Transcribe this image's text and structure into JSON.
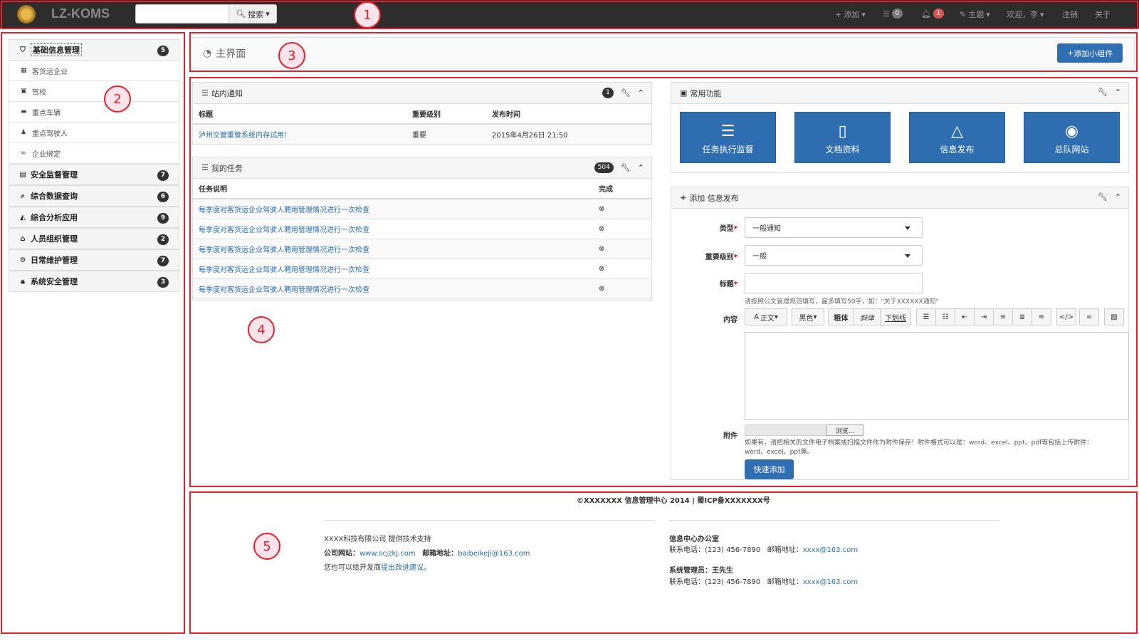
{
  "navbar": {
    "brand": "LZ-KOMS",
    "search_label": "搜索",
    "add_label": "添加",
    "messages_count": "0",
    "alerts_count": "1",
    "theme_label": "主题",
    "welcome_label": "欢迎，李",
    "logout_label": "注销",
    "about_label": "关于"
  },
  "sidebar": {
    "groups": [
      {
        "label": "基础信息管理",
        "count": "5",
        "icon": "shield-icon"
      },
      {
        "label": "安全监督管理",
        "count": "7",
        "icon": "book-icon"
      },
      {
        "label": "综合数据查询",
        "count": "6",
        "icon": "search-icon"
      },
      {
        "label": "综合分析应用",
        "count": "9",
        "icon": "chart-icon"
      },
      {
        "label": "人员组织管理",
        "count": "2",
        "icon": "institution-icon"
      },
      {
        "label": "日常维护管理",
        "count": "7",
        "icon": "gears-icon"
      },
      {
        "label": "系统安全管理",
        "count": "3",
        "icon": "lock-icon"
      }
    ],
    "sub_items": [
      {
        "label": "客货运企业",
        "icon": "building-icon"
      },
      {
        "label": "驾校",
        "icon": "car-icon"
      },
      {
        "label": "重点车辆",
        "icon": "truck-icon"
      },
      {
        "label": "重点驾驶人",
        "icon": "person-icon"
      },
      {
        "label": "企业绑定",
        "icon": "link-icon"
      }
    ]
  },
  "main": {
    "title": "主界面",
    "add_widget_label": "添加小组件"
  },
  "notices": {
    "title": "站内通知",
    "count": "1",
    "columns": [
      "标题",
      "重要级别",
      "发布时间"
    ],
    "rows": [
      {
        "title": "泸州交管重管系统内存试用！",
        "level": "重要",
        "time": "2015年4月26日 21:50"
      }
    ]
  },
  "tasks": {
    "title": "我的任务",
    "count": "504",
    "columns": [
      "任务说明",
      "完成"
    ],
    "rows": [
      "每季度对客货运企业驾驶人聘用管理情况进行一次检查",
      "每季度对客货运企业驾驶人聘用管理情况进行一次检查",
      "每季度对客货运企业驾驶人聘用管理情况进行一次检查",
      "每季度对客货运企业驾驶人聘用管理情况进行一次检查",
      "每季度对客货运企业驾驶人聘用管理情况进行一次检查"
    ]
  },
  "quick": {
    "title": "常用功能",
    "tiles": [
      {
        "label": "任务执行监督",
        "icon": "server-icon"
      },
      {
        "label": "文档资料",
        "icon": "file-zip-icon"
      },
      {
        "label": "信息发布",
        "icon": "bell-icon"
      },
      {
        "label": "总队网站",
        "icon": "globe-icon"
      }
    ]
  },
  "publish": {
    "title": "添加 信息发布",
    "type_label": "类型",
    "type_value": "一般通知",
    "level_label": "重要级别",
    "level_value": "一般",
    "subject_label": "标题",
    "subject_value": "",
    "subject_help": "请按照公文管理规范填写，最多填写50字，如：\"关于XXXXXX通知\"",
    "content_label": "内容",
    "toolbar": {
      "font": "正文",
      "color": "黑色",
      "bold": "粗体",
      "italic": "斜体",
      "underline": "下划线"
    },
    "attach_label": "附件",
    "browse_label": "浏览...",
    "attach_help_1": "如果有，请把相关的文件电子档案或扫描文件作为附件保存！附件格式可以是：word、excel、ppt、pdf等包括上传附件：",
    "attach_help_2": "word、excel、ppt等。",
    "submit_label": "快速添加"
  },
  "footer": {
    "copyright": "©XXXXXXX 信息管理中心 2014 | 蜀ICP备XXXXXXX号",
    "support": "XXXX科技有限公司 提供技术支持",
    "site_label": "公司网站：",
    "site_url": "www.scjzkj.com",
    "email_label": "邮箱地址：",
    "email": "baibeikeji@163.com",
    "suggest_prefix": "您也可以给开发商",
    "suggest_link": "提出改进建议",
    "suggest_suffix": "。",
    "office_title": "信息中心办公室",
    "office_phone_label": "联系电话：",
    "office_phone": "(123) 456-7890",
    "office_mail_label": "邮箱地址：",
    "office_mail": "xxxx@163.com",
    "admin_title": "系统管理员：王先生",
    "admin_phone_label": "联系电话：",
    "admin_phone": "(123) 456-7890",
    "admin_mail_label": "邮箱地址：",
    "admin_mail": "xxxx@163.com"
  },
  "annotations": [
    "1",
    "2",
    "3",
    "4",
    "5"
  ],
  "colors": {
    "accent": "#2f6fb1",
    "annotation": "#e8202e",
    "navbar": "#2d2d2d"
  }
}
